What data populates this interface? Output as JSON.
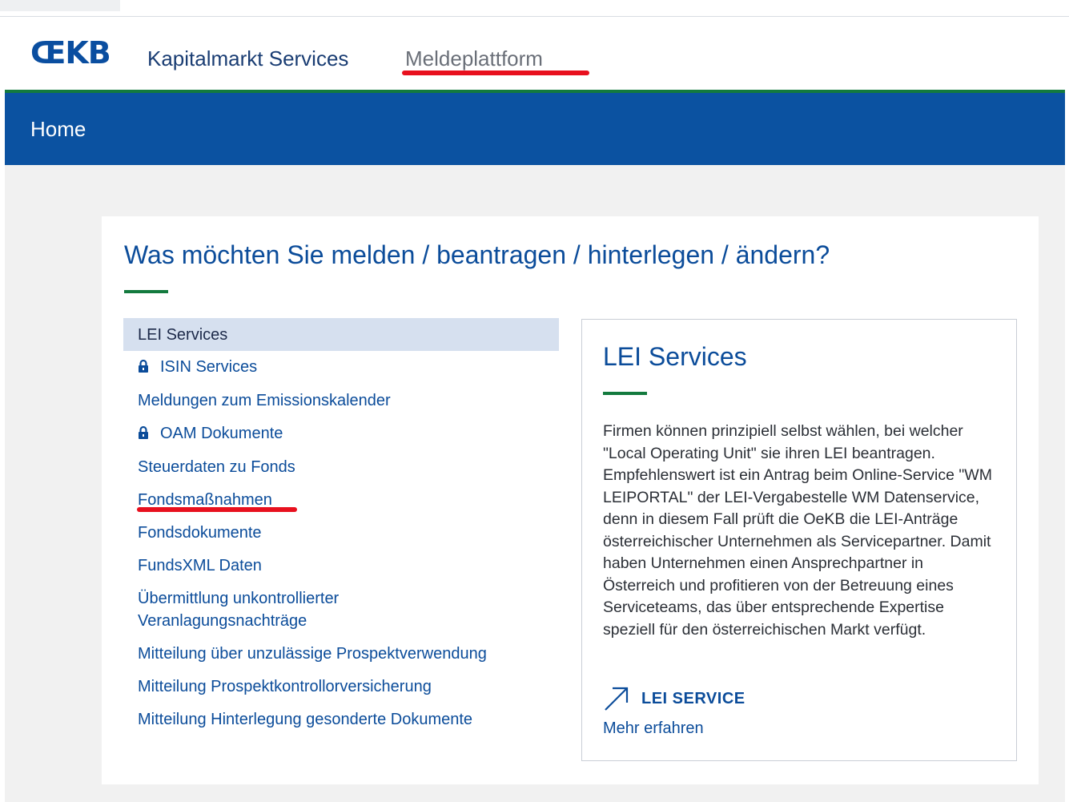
{
  "header": {
    "logo": "ŒKB",
    "nav": {
      "kapitalmarkt": "Kapitalmarkt Services",
      "meldeplattform": "Meldeplattform"
    }
  },
  "home_bar": {
    "home": "Home"
  },
  "main": {
    "title": "Was möchten Sie melden / beantragen / hinterlegen / ändern?",
    "menu": [
      {
        "label": "LEI Services",
        "locked": false,
        "active": true
      },
      {
        "label": "ISIN Services",
        "locked": true
      },
      {
        "label": "Meldungen zum Emissionskalender"
      },
      {
        "label": "OAM Dokumente",
        "locked": true
      },
      {
        "label": "Steuerdaten zu Fonds"
      },
      {
        "label": "Fondsmaßnahmen"
      },
      {
        "label": "Fondsdokumente"
      },
      {
        "label": "FundsXML Daten"
      },
      {
        "label": "Übermittlung unkontrollierter Veranlagungsnachträge"
      },
      {
        "label": "Mitteilung über unzulässige Prospektverwendung"
      },
      {
        "label": "Mitteilung Prospektkontrollorversicherung"
      },
      {
        "label": "Mitteilung Hinterlegung gesonderte Dokumente"
      }
    ],
    "info": {
      "title": "LEI Services",
      "text": "Firmen können prinzipiell selbst wählen, bei welcher \"Local Operating Unit\" sie ihren LEI beantragen. Empfehlenswert ist ein Antrag beim Online-Service \"WM LEIPORTAL\" der LEI-Vergabestelle WM Datenservice, denn in diesem Fall prüft die OeKB die LEI-Anträge österreichischer Unternehmen als Servicepartner. Damit haben Unternehmen einen Ansprechpartner in Österreich und profitieren von der Betreuung eines Serviceteams, das über entsprechende Expertise speziell für den österreichischen Markt verfügt.",
      "link_label": "LEI SERVICE",
      "more": "Mehr erfahren"
    }
  },
  "colors": {
    "brand_blue": "#0b52a1",
    "text_blue": "#0b4c9a",
    "accent_green": "#137a3e",
    "annotation_red": "#e8101e",
    "active_item_bg": "#d6e0ef"
  }
}
